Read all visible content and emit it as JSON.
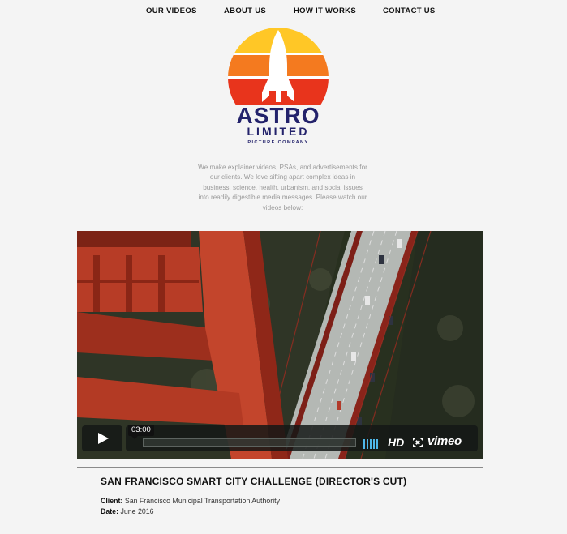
{
  "nav": {
    "items": [
      {
        "label": "OUR VIDEOS"
      },
      {
        "label": "ABOUT US"
      },
      {
        "label": "HOW IT WORKS"
      },
      {
        "label": "CONTACT US"
      }
    ]
  },
  "logo": {
    "line1": "ASTRO",
    "line2": "LIMITED",
    "line3": "PICTURE COMPANY",
    "colors": {
      "yellow": "#ffc726",
      "orange": "#f47a1f",
      "red": "#e8341c",
      "navy": "#23226b"
    }
  },
  "intro": {
    "text": "We make explainer videos, PSAs, and advertisements for our clients. We love sifting apart complex ideas in business, science, health, urbanism, and social issues into readily digestible media messages. Please watch our videos below:"
  },
  "video": {
    "time": "03:00",
    "progress": 0,
    "hd_label": "HD",
    "brand": "vimeo",
    "icons": {
      "play": "play-icon",
      "volume": "volume-icon",
      "fullscreen": "fullscreen-icon"
    }
  },
  "project": {
    "title": "SAN FRANCISCO SMART CITY CHALLENGE (DIRECTOR'S CUT)",
    "client_label": "Client:",
    "client": "San Francisco Municipal Transportation Authority",
    "date_label": "Date:",
    "date": "June 2016"
  }
}
